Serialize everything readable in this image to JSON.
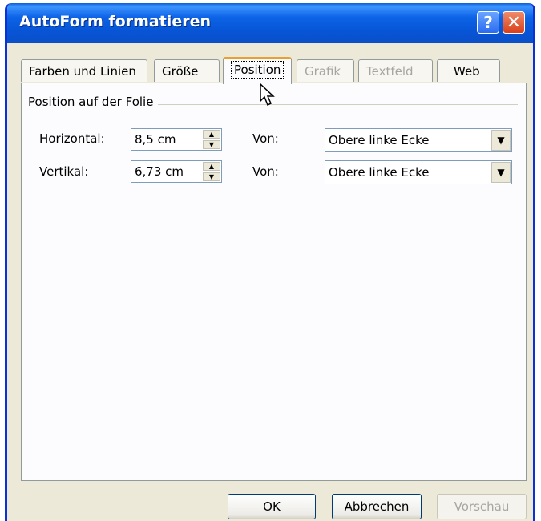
{
  "window": {
    "title": "AutoForm formatieren",
    "help_icon": "help-icon",
    "close_icon": "close-icon"
  },
  "tabs": [
    {
      "label": "Farben und Linien",
      "state": "normal"
    },
    {
      "label": "Größe",
      "state": "normal"
    },
    {
      "label": "Position",
      "state": "active"
    },
    {
      "label": "Grafik",
      "state": "disabled"
    },
    {
      "label": "Textfeld",
      "state": "disabled"
    },
    {
      "label": "Web",
      "state": "normal"
    }
  ],
  "group": {
    "label": "Position auf der Folie"
  },
  "horizontal": {
    "label": "Horizontal:",
    "value": "8,5 cm",
    "from_label": "Von:",
    "from_value": "Obere linke Ecke"
  },
  "vertical": {
    "label": "Vertikal:",
    "value": "6,73 cm",
    "from_label": "Von:",
    "from_value": "Obere linke Ecke"
  },
  "buttons": {
    "ok": "OK",
    "cancel": "Abbrechen",
    "preview": "Vorschau"
  },
  "colors": {
    "titlebar": "#0755d6",
    "dialog_bg": "#ece9d8",
    "active_tab_accent": "#e8a130"
  }
}
